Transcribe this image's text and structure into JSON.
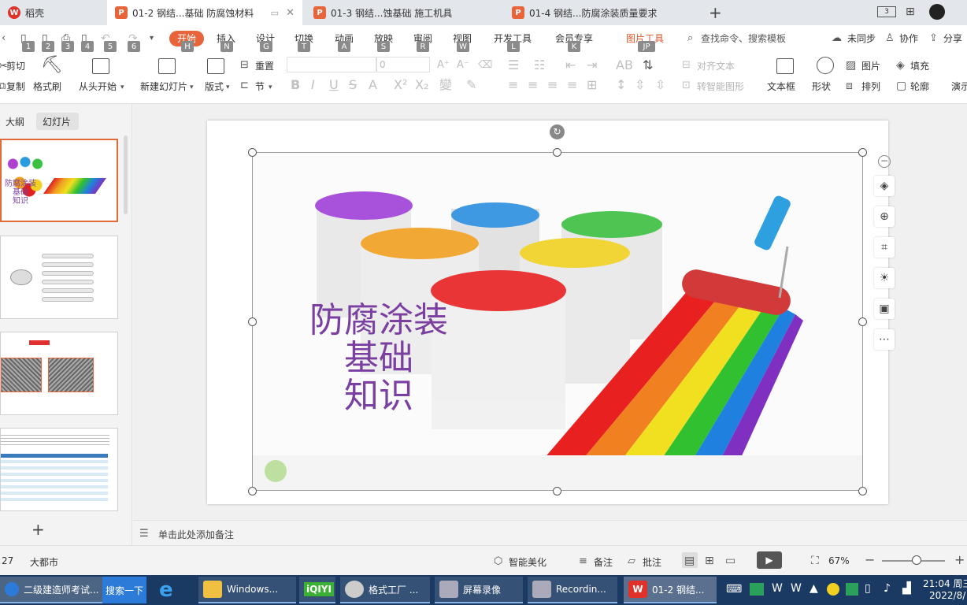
{
  "tabs": [
    {
      "label": "稻壳",
      "icon": "daoke-icon",
      "color": "#e0312b"
    },
    {
      "label": "01-2  钢结...基础 防腐蚀材料",
      "icon": "ppt-icon",
      "color": "#e8643a"
    },
    {
      "label": "01-3  钢结...蚀基础 施工机具",
      "icon": "ppt-icon",
      "color": "#e8643a"
    },
    {
      "label": "01-4  钢结...防腐涂装质量要求",
      "icon": "ppt-icon",
      "color": "#e8643a"
    }
  ],
  "titlebar": {
    "new_tab": "+",
    "layout_badge": "3"
  },
  "menu": {
    "items": [
      "开始",
      "插入",
      "设计",
      "切换",
      "动画",
      "放映",
      "审阅",
      "视图",
      "开发工具",
      "会员专享",
      "图片工具"
    ],
    "keytips": [
      "H",
      "N",
      "G",
      "T",
      "A",
      "S",
      "R",
      "W",
      "L",
      "K",
      "JP"
    ],
    "qa_keytips": [
      "1",
      "2",
      "3",
      "4",
      "5",
      "6"
    ],
    "search": "查找命令、搜索模板",
    "unsync": "未同步",
    "collab": "协作",
    "share": "分享"
  },
  "ribbon": {
    "cut": "剪切",
    "copy": "复制",
    "format_painter": "格式刷",
    "from_start": "从头开始",
    "new_slide": "新建幻灯片",
    "layout": "版式",
    "reset": "重置",
    "section": "节",
    "font_size": "0",
    "align_text": "对齐文本",
    "smart_graphic": "转智能图形",
    "textbox": "文本框",
    "shape": "形状",
    "picture": "图片",
    "fill": "填充",
    "arrange": "排列",
    "outline": "轮廓",
    "present": "演示"
  },
  "panel": {
    "tab_outline": "大纲",
    "tab_slides": "幻灯片",
    "add": "+"
  },
  "slide": {
    "title_lines": [
      "防腐涂装",
      "基础",
      "知识"
    ],
    "title_color": "#7a3fa0"
  },
  "notes": {
    "placeholder": "单击此处添加备注"
  },
  "status": {
    "slide_num": "27",
    "theme": "大都市",
    "beautify": "智能美化",
    "notes": "备注",
    "comments": "批注",
    "zoom": "67%",
    "zoom_level": 0.55
  },
  "taskbar": {
    "items": [
      "二级建造师考试...",
      "搜索一下",
      "",
      "Windows...",
      "iQIYI",
      "格式工厂 ...",
      "屏幕录像",
      "Recordin...",
      "01-2  钢结..."
    ],
    "time": "21:04 周三",
    "date": "2022/8/"
  }
}
